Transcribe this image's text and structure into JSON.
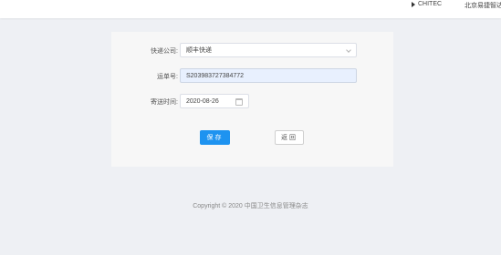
{
  "header": {
    "brand": "CHITEC",
    "org": "北京易捷智达"
  },
  "form": {
    "courier": {
      "label": "快递公司:",
      "value": "顺丰快递"
    },
    "tracking": {
      "label": "运单号:",
      "value": "S203983727384772"
    },
    "send_time": {
      "label": "寄送时间:",
      "value": "2020-08-26"
    },
    "save_label": "保存",
    "back_label": "返回"
  },
  "footer": {
    "copyright": "Copyright © 2020 中国卫生信息管理杂志"
  },
  "colors": {
    "primary": "#1e93f0",
    "page_bg": "#eef0f4",
    "highlight_field": "#e8f0fe"
  }
}
